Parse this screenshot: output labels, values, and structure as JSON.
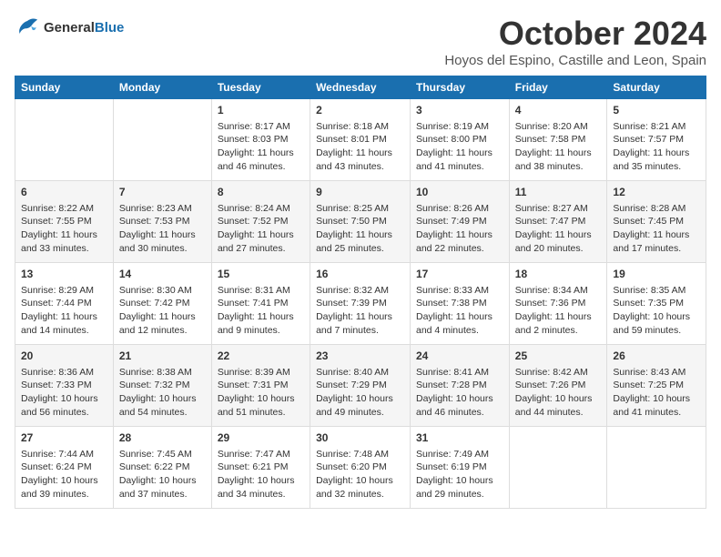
{
  "logo": {
    "line1": "General",
    "line2": "Blue"
  },
  "title": "October 2024",
  "location": "Hoyos del Espino, Castille and Leon, Spain",
  "days_of_week": [
    "Sunday",
    "Monday",
    "Tuesday",
    "Wednesday",
    "Thursday",
    "Friday",
    "Saturday"
  ],
  "weeks": [
    [
      {
        "day": "",
        "info": ""
      },
      {
        "day": "",
        "info": ""
      },
      {
        "day": "1",
        "info": "Sunrise: 8:17 AM\nSunset: 8:03 PM\nDaylight: 11 hours and 46 minutes."
      },
      {
        "day": "2",
        "info": "Sunrise: 8:18 AM\nSunset: 8:01 PM\nDaylight: 11 hours and 43 minutes."
      },
      {
        "day": "3",
        "info": "Sunrise: 8:19 AM\nSunset: 8:00 PM\nDaylight: 11 hours and 41 minutes."
      },
      {
        "day": "4",
        "info": "Sunrise: 8:20 AM\nSunset: 7:58 PM\nDaylight: 11 hours and 38 minutes."
      },
      {
        "day": "5",
        "info": "Sunrise: 8:21 AM\nSunset: 7:57 PM\nDaylight: 11 hours and 35 minutes."
      }
    ],
    [
      {
        "day": "6",
        "info": "Sunrise: 8:22 AM\nSunset: 7:55 PM\nDaylight: 11 hours and 33 minutes."
      },
      {
        "day": "7",
        "info": "Sunrise: 8:23 AM\nSunset: 7:53 PM\nDaylight: 11 hours and 30 minutes."
      },
      {
        "day": "8",
        "info": "Sunrise: 8:24 AM\nSunset: 7:52 PM\nDaylight: 11 hours and 27 minutes."
      },
      {
        "day": "9",
        "info": "Sunrise: 8:25 AM\nSunset: 7:50 PM\nDaylight: 11 hours and 25 minutes."
      },
      {
        "day": "10",
        "info": "Sunrise: 8:26 AM\nSunset: 7:49 PM\nDaylight: 11 hours and 22 minutes."
      },
      {
        "day": "11",
        "info": "Sunrise: 8:27 AM\nSunset: 7:47 PM\nDaylight: 11 hours and 20 minutes."
      },
      {
        "day": "12",
        "info": "Sunrise: 8:28 AM\nSunset: 7:45 PM\nDaylight: 11 hours and 17 minutes."
      }
    ],
    [
      {
        "day": "13",
        "info": "Sunrise: 8:29 AM\nSunset: 7:44 PM\nDaylight: 11 hours and 14 minutes."
      },
      {
        "day": "14",
        "info": "Sunrise: 8:30 AM\nSunset: 7:42 PM\nDaylight: 11 hours and 12 minutes."
      },
      {
        "day": "15",
        "info": "Sunrise: 8:31 AM\nSunset: 7:41 PM\nDaylight: 11 hours and 9 minutes."
      },
      {
        "day": "16",
        "info": "Sunrise: 8:32 AM\nSunset: 7:39 PM\nDaylight: 11 hours and 7 minutes."
      },
      {
        "day": "17",
        "info": "Sunrise: 8:33 AM\nSunset: 7:38 PM\nDaylight: 11 hours and 4 minutes."
      },
      {
        "day": "18",
        "info": "Sunrise: 8:34 AM\nSunset: 7:36 PM\nDaylight: 11 hours and 2 minutes."
      },
      {
        "day": "19",
        "info": "Sunrise: 8:35 AM\nSunset: 7:35 PM\nDaylight: 10 hours and 59 minutes."
      }
    ],
    [
      {
        "day": "20",
        "info": "Sunrise: 8:36 AM\nSunset: 7:33 PM\nDaylight: 10 hours and 56 minutes."
      },
      {
        "day": "21",
        "info": "Sunrise: 8:38 AM\nSunset: 7:32 PM\nDaylight: 10 hours and 54 minutes."
      },
      {
        "day": "22",
        "info": "Sunrise: 8:39 AM\nSunset: 7:31 PM\nDaylight: 10 hours and 51 minutes."
      },
      {
        "day": "23",
        "info": "Sunrise: 8:40 AM\nSunset: 7:29 PM\nDaylight: 10 hours and 49 minutes."
      },
      {
        "day": "24",
        "info": "Sunrise: 8:41 AM\nSunset: 7:28 PM\nDaylight: 10 hours and 46 minutes."
      },
      {
        "day": "25",
        "info": "Sunrise: 8:42 AM\nSunset: 7:26 PM\nDaylight: 10 hours and 44 minutes."
      },
      {
        "day": "26",
        "info": "Sunrise: 8:43 AM\nSunset: 7:25 PM\nDaylight: 10 hours and 41 minutes."
      }
    ],
    [
      {
        "day": "27",
        "info": "Sunrise: 7:44 AM\nSunset: 6:24 PM\nDaylight: 10 hours and 39 minutes."
      },
      {
        "day": "28",
        "info": "Sunrise: 7:45 AM\nSunset: 6:22 PM\nDaylight: 10 hours and 37 minutes."
      },
      {
        "day": "29",
        "info": "Sunrise: 7:47 AM\nSunset: 6:21 PM\nDaylight: 10 hours and 34 minutes."
      },
      {
        "day": "30",
        "info": "Sunrise: 7:48 AM\nSunset: 6:20 PM\nDaylight: 10 hours and 32 minutes."
      },
      {
        "day": "31",
        "info": "Sunrise: 7:49 AM\nSunset: 6:19 PM\nDaylight: 10 hours and 29 minutes."
      },
      {
        "day": "",
        "info": ""
      },
      {
        "day": "",
        "info": ""
      }
    ]
  ]
}
